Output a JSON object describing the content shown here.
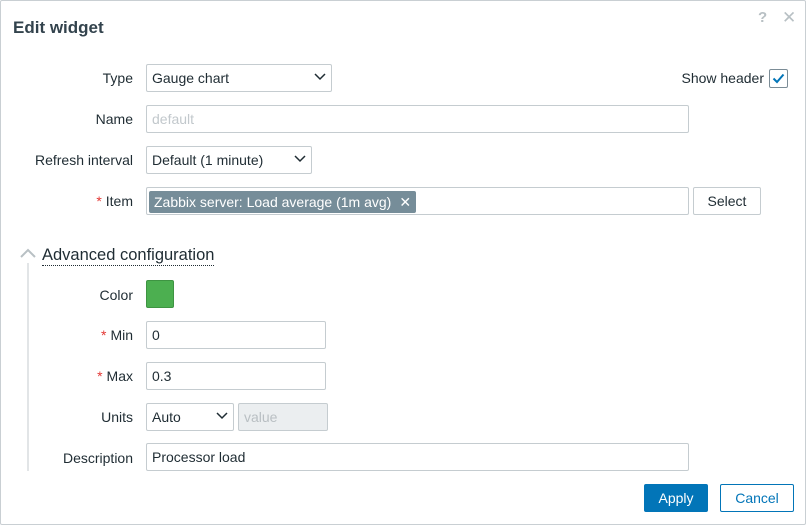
{
  "dialog": {
    "title": "Edit widget",
    "help_glyph": "?",
    "close_glyph": "✕"
  },
  "form": {
    "type": {
      "label": "Type",
      "value": "Gauge chart"
    },
    "show_header": {
      "label": "Show header",
      "checked": true
    },
    "name": {
      "label": "Name",
      "placeholder": "default",
      "value": ""
    },
    "refresh": {
      "label": "Refresh interval",
      "value": "Default (1 minute)"
    },
    "item": {
      "label": "Item",
      "required_mark": "*",
      "tag": "Zabbix server: Load average (1m avg)",
      "remove_glyph": "✕",
      "select_label": "Select"
    }
  },
  "advanced": {
    "title": "Advanced configuration",
    "color": {
      "label": "Color",
      "value": "#4caf50"
    },
    "min": {
      "label": "Min",
      "required_mark": "*",
      "value": "0"
    },
    "max": {
      "label": "Max",
      "required_mark": "*",
      "value": "0.3"
    },
    "units": {
      "label": "Units",
      "value": "Auto",
      "value_placeholder": "value"
    },
    "description": {
      "label": "Description",
      "value": "Processor load"
    }
  },
  "footer": {
    "apply_label": "Apply",
    "cancel_label": "Cancel"
  },
  "colors": {
    "accent": "#0275b8",
    "required": "#e33734",
    "tag_bg": "#768d99",
    "swatch": "#4caf50"
  }
}
